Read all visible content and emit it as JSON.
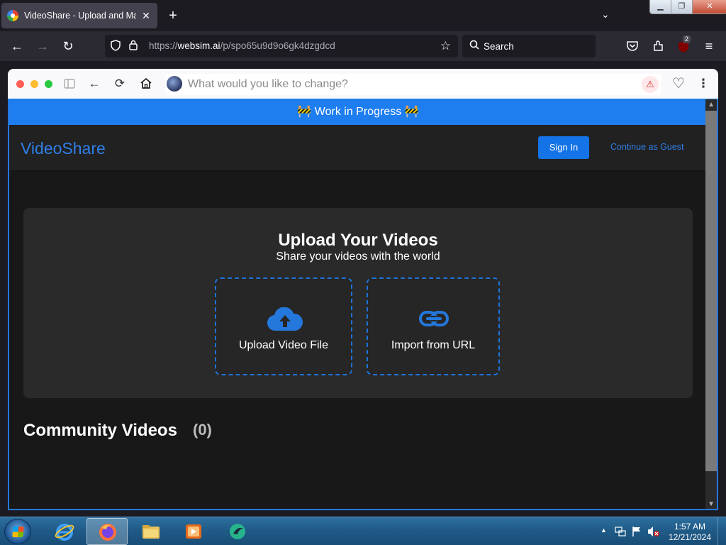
{
  "browser": {
    "tab_title": "VideoShare - Upload and Mana",
    "url_prefix": "https://",
    "url_domain": "websim.ai",
    "url_path": "/p/spo65u9d9o6gk4dzgdcd",
    "search_label": "Search",
    "extension_badge": "2"
  },
  "websim": {
    "prompt_placeholder": "What would you like to change?"
  },
  "page": {
    "banner": "🚧 Work in Progress 🚧",
    "brand": "VideoShare",
    "signin_label": "Sign In",
    "guest_label": "Continue as Guest",
    "upload_title": "Upload Your Videos",
    "upload_subtitle": "Share your videos with the world",
    "upload_file_label": "Upload Video File",
    "import_url_label": "Import from URL",
    "community_title": "Community Videos",
    "community_count": "(0)",
    "accent_color": "#1e7ef0"
  },
  "taskbar": {
    "time": "1:57 AM",
    "date": "12/21/2024"
  }
}
